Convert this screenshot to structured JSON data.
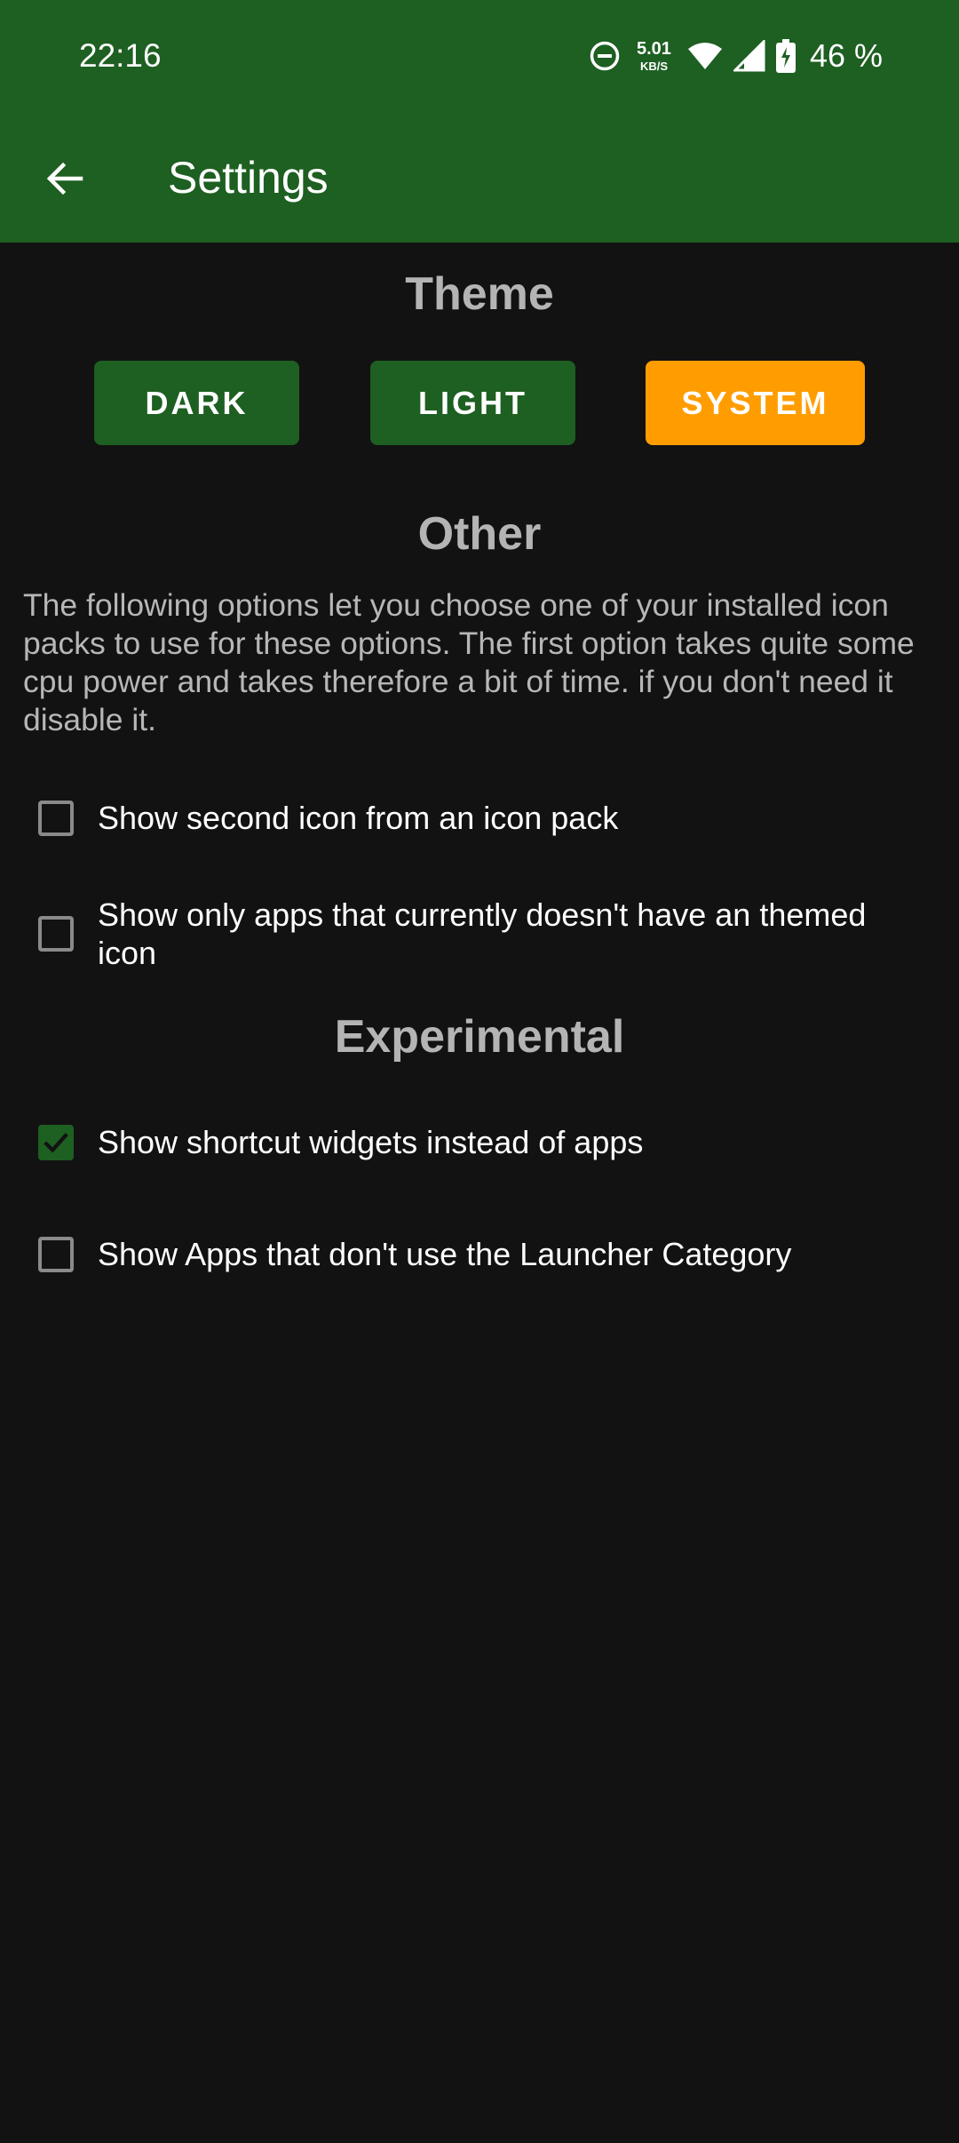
{
  "status_bar": {
    "time": "22:16",
    "net_speed_value": "5.01",
    "net_speed_unit": "KB/S",
    "battery": "46 %",
    "icons": [
      "do-not-disturb-icon",
      "wifi-icon",
      "signal-icon",
      "battery-charging-icon"
    ]
  },
  "toolbar": {
    "title": "Settings",
    "back_icon": "arrow-back-icon"
  },
  "theme": {
    "title": "Theme",
    "options": [
      "DARK",
      "LIGHT",
      "SYSTEM"
    ],
    "selected": "SYSTEM"
  },
  "other": {
    "title": "Other",
    "description": "The following options let you choose one of your installed icon packs to use for these options. The first option takes quite some cpu power and takes therefore a bit of time. if you don't need it disable it.",
    "options": [
      {
        "label": "Show second icon from an icon pack",
        "checked": false
      },
      {
        "label": "Show only apps that currently doesn't have an themed icon",
        "checked": false
      }
    ]
  },
  "experimental": {
    "title": "Experimental",
    "options": [
      {
        "label": "Show shortcut widgets instead of apps",
        "checked": true
      },
      {
        "label": "Show Apps that don't use the Launcher Category",
        "checked": false
      }
    ]
  },
  "colors": {
    "header": "#1e5f22",
    "accent": "#ff9d00",
    "background": "#121212",
    "section_title": "#b4b4b4"
  }
}
